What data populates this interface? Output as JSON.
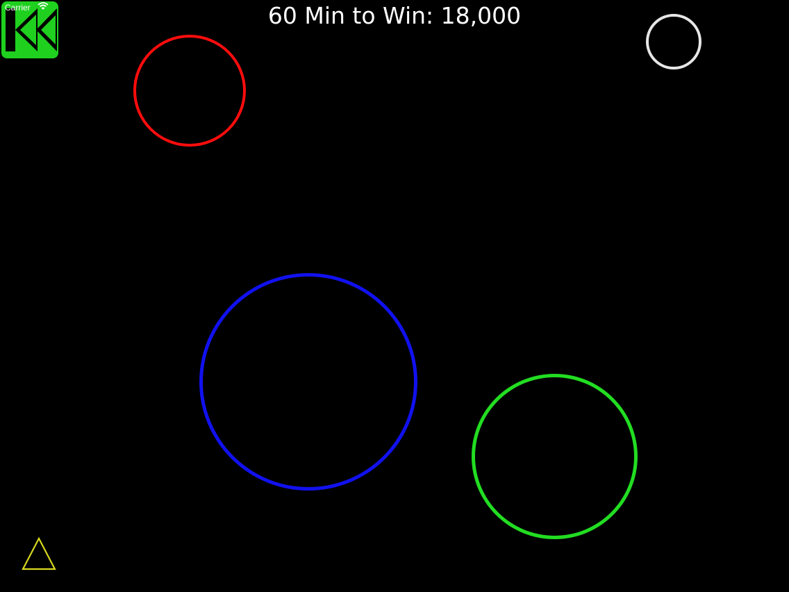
{
  "status_bar": {
    "carrier": "Carrier"
  },
  "hud": {
    "title": "60 Min to Win: 18,000"
  },
  "controls": {
    "back_button_icon": "rewind-double-chevron-icon"
  },
  "rings": [
    {
      "name": "red-ring",
      "color": "#ff0d0d"
    },
    {
      "name": "white-ring",
      "color": "#e6e6e6"
    },
    {
      "name": "blue-ring",
      "color": "#1111ee"
    },
    {
      "name": "green-ring",
      "color": "#22dd22"
    }
  ],
  "player": {
    "shape": "triangle",
    "color": "#d8d820"
  },
  "colors": {
    "background": "#000000",
    "button": "#1fd01f"
  }
}
